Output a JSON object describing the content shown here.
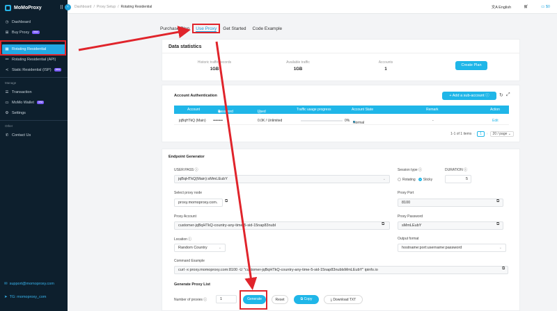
{
  "sidebar": {
    "brand": "MoMoProxy",
    "items": [
      {
        "label": "Dashboard",
        "icon": "dashboard-icon"
      },
      {
        "label": "Buy Proxy",
        "icon": "cart-icon",
        "badge": "new"
      },
      {
        "label": "Rotating Residential",
        "icon": "grid-icon"
      },
      {
        "label": "Rotating Residential (API)",
        "icon": "link-icon"
      },
      {
        "label": "Static Residential (ISP)",
        "icon": "share-icon",
        "badge": "new"
      }
    ],
    "manage_label": "Manage",
    "manage_items": [
      {
        "label": "Transaction",
        "icon": "receipt-icon"
      },
      {
        "label": "MoMo Wallet",
        "icon": "wallet-icon",
        "badge": "new"
      },
      {
        "label": "Settings",
        "icon": "gear-icon"
      }
    ],
    "other_label": "Other",
    "other_items": [
      {
        "label": "Contact Us",
        "icon": "phone-icon"
      }
    ],
    "footer_email": "support@momoproxy.com",
    "footer_tg": "TG: momoproxy_com"
  },
  "topbar": {
    "breadcrumb": [
      "Dashboard",
      "Proxy Setup",
      "Rotating Residential"
    ],
    "language": "English",
    "balance": "$0"
  },
  "tabs": [
    "Purchase Plan",
    "Use Proxy",
    "Get Started",
    "Code Example"
  ],
  "stats": {
    "title": "Data statistics",
    "historic_label": "Historic traffic records",
    "historic_value": "1GB",
    "available_label": "Available traffic",
    "available_value": "1GB",
    "accounts_label": "Accounts",
    "accounts_value": "1",
    "create_plan": "Create Plan"
  },
  "auth": {
    "title": "Account Authentication",
    "add_button": "+ Add a sub-account",
    "columns": [
      "Account",
      "Password",
      "Used / Limit",
      "Traffic usage progress",
      "Account State",
      "Remark",
      "Action"
    ],
    "row": {
      "account": "jqBqHTkQ (Main)",
      "password": "••••••••",
      "used": "0.0K / Unlimited",
      "progress": "0%",
      "progress_value": 0,
      "state": "Normal",
      "remark": "-",
      "action": "Edit"
    },
    "pager": {
      "range": "1-1 of 1 items",
      "page": "1",
      "per_page": "20 / page"
    }
  },
  "endpoint": {
    "title": "Endpoint Generator",
    "userpass_label": "USER:PASS",
    "userpass_value": "jqBqHTkQ(Main):sMmLEubY",
    "session_label": "Session type",
    "session_rotating": "Rotating",
    "session_sticky": "Sticky",
    "duration_label": "DURATION",
    "duration_value": "5",
    "node_label": "Select proxy node",
    "node_value": "proxy.momoproxy.com",
    "port_label": "Proxy Port",
    "port_value": "8100",
    "account_label": "Proxy Account",
    "account_value": "customer-jqBqHTkQ-country-any-time-5-sid-15nap83nubl",
    "password_label": "Proxy Password",
    "password_value": "sMmLEubY",
    "location_label": "Location",
    "location_value": "Random Country",
    "output_label": "Output format",
    "output_value": "hostname:port:username:password",
    "command_label": "Command Example",
    "command_value": "curl -x proxy.momoproxy.com:8100 -U \"customer-jqBqHTkQ-country-any-time-5-sid-15nap83nublsMmLEubY\" ipinfo.io",
    "list_title": "Generate Proxy List",
    "num_label": "Number of proxies",
    "num_value": "1",
    "generate": "Generate",
    "reset": "Reset",
    "copy": "Copy",
    "download": "Download TXT"
  },
  "colors": {
    "accent": "#1fb6e8",
    "sidebar": "#0d1f2d",
    "annotation": "#e0242b"
  }
}
